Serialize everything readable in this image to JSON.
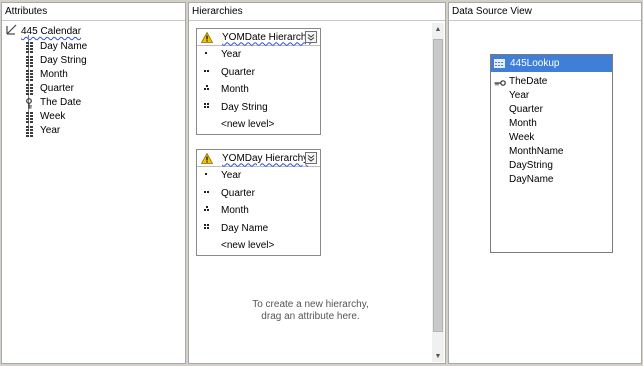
{
  "attributes": {
    "header": "Attributes",
    "root": "445 Calendar",
    "items": [
      "Day Name",
      "Day String",
      "Month",
      "Quarter",
      "The Date",
      "Week",
      "Year"
    ]
  },
  "hierarchies": {
    "header": "Hierarchies",
    "boxes": [
      {
        "title": "YOMDate Hierarchy",
        "levels": [
          "Year",
          "Quarter",
          "Month",
          "Day String"
        ],
        "new_level": "<new level>"
      },
      {
        "title": "YOMDay Hierarchy",
        "levels": [
          "Year",
          "Quarter",
          "Month",
          "Day Name"
        ],
        "new_level": "<new level>"
      }
    ],
    "hint_line1": "To create a new hierarchy,",
    "hint_line2": "drag an attribute here."
  },
  "dsv": {
    "header": "Data Source View",
    "table_name": "445Lookup",
    "columns": [
      "TheDate",
      "Year",
      "Quarter",
      "Month",
      "Week",
      "MonthName",
      "DayString",
      "DayName"
    ]
  },
  "icons": {
    "dimension": "dimension-icon",
    "attribute": "attribute-icon",
    "key_attribute": "key-attribute-icon",
    "warning": "warning-icon",
    "collapse": "collapse-icon",
    "table": "table-icon",
    "key_column": "key-column-icon"
  },
  "colors": {
    "dsv_header": "#3f7fd8",
    "warning": "#f5c400",
    "squiggle": "#2f4fd9"
  }
}
